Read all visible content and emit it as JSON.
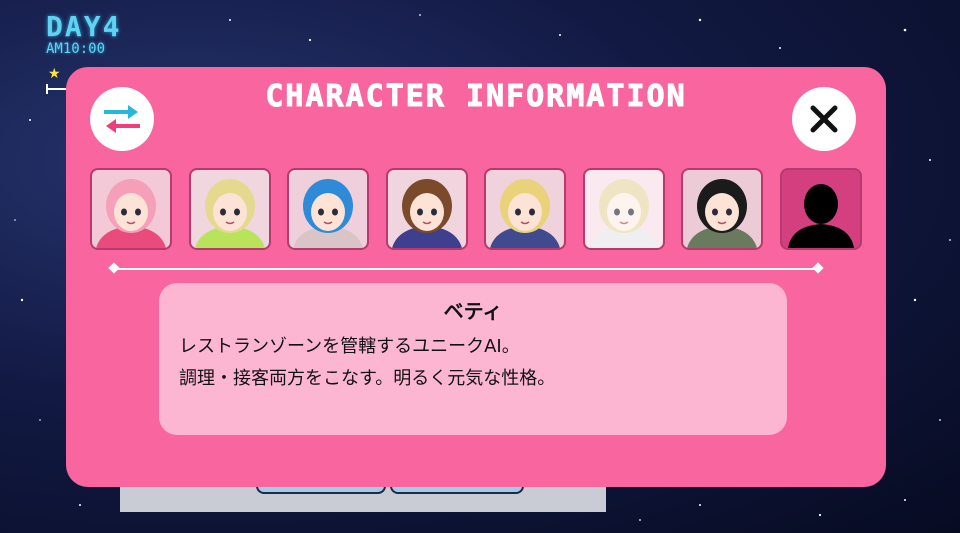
{
  "hud": {
    "day": "DAY4",
    "time": "AM10:00",
    "star_icon": "star-icon"
  },
  "modal": {
    "title": "CHARACTER INFORMATION",
    "swap_icon": "swap-arrows-icon",
    "close_icon": "close-icon",
    "colors": {
      "panel": "#f8659f",
      "info_box": "#fdb6d2",
      "arrow_blue": "#27b7d9",
      "arrow_red": "#ef3e7c"
    }
  },
  "portraits": [
    {
      "name": "portrait-pink-hair",
      "hair": "#f59fb9",
      "skin": "#fde3d6",
      "outfit": "#e84b7c",
      "bg": "#f3c9d8",
      "locked": false,
      "selected": false
    },
    {
      "name": "portrait-blonde-green",
      "hair": "#e5d98f",
      "skin": "#fde3d6",
      "outfit": "#b8e35a",
      "bg": "#f0d7df",
      "locked": false,
      "selected": false
    },
    {
      "name": "portrait-blue-hair",
      "hair": "#2f8ad8",
      "skin": "#fde3d6",
      "outfit": "#d9c4c7",
      "bg": "#efcfdb",
      "locked": false,
      "selected": false
    },
    {
      "name": "portrait-brown-hair",
      "hair": "#7a4a2b",
      "skin": "#fde3d6",
      "outfit": "#3f3f8f",
      "bg": "#f0d4de",
      "locked": false,
      "selected": false
    },
    {
      "name": "portrait-blonde-short",
      "hair": "#e9d27a",
      "skin": "#fde3d6",
      "outfit": "#3f4a8f",
      "bg": "#efd2dc",
      "locked": false,
      "selected": false
    },
    {
      "name": "portrait-betty-selected",
      "hair": "#e7d7a6",
      "skin": "#fdeee6",
      "outfit": "#e6e6ea",
      "bg": "#f7dde6",
      "locked": false,
      "selected": true
    },
    {
      "name": "portrait-black-hair",
      "hair": "#1b1b1b",
      "skin": "#fde3d6",
      "outfit": "#6a7a5f",
      "bg": "#edcbd6",
      "locked": false,
      "selected": false
    },
    {
      "name": "portrait-locked-silhouette",
      "hair": "#000000",
      "skin": "#000000",
      "outfit": "#000000",
      "bg": "#d33f7f",
      "locked": true,
      "selected": false
    }
  ],
  "info": {
    "name": "ベティ",
    "line1": "レストランゾーンを管轄するユニークAI。",
    "line2": "調理・接客両方をこなす。明るく元気な性格。"
  }
}
